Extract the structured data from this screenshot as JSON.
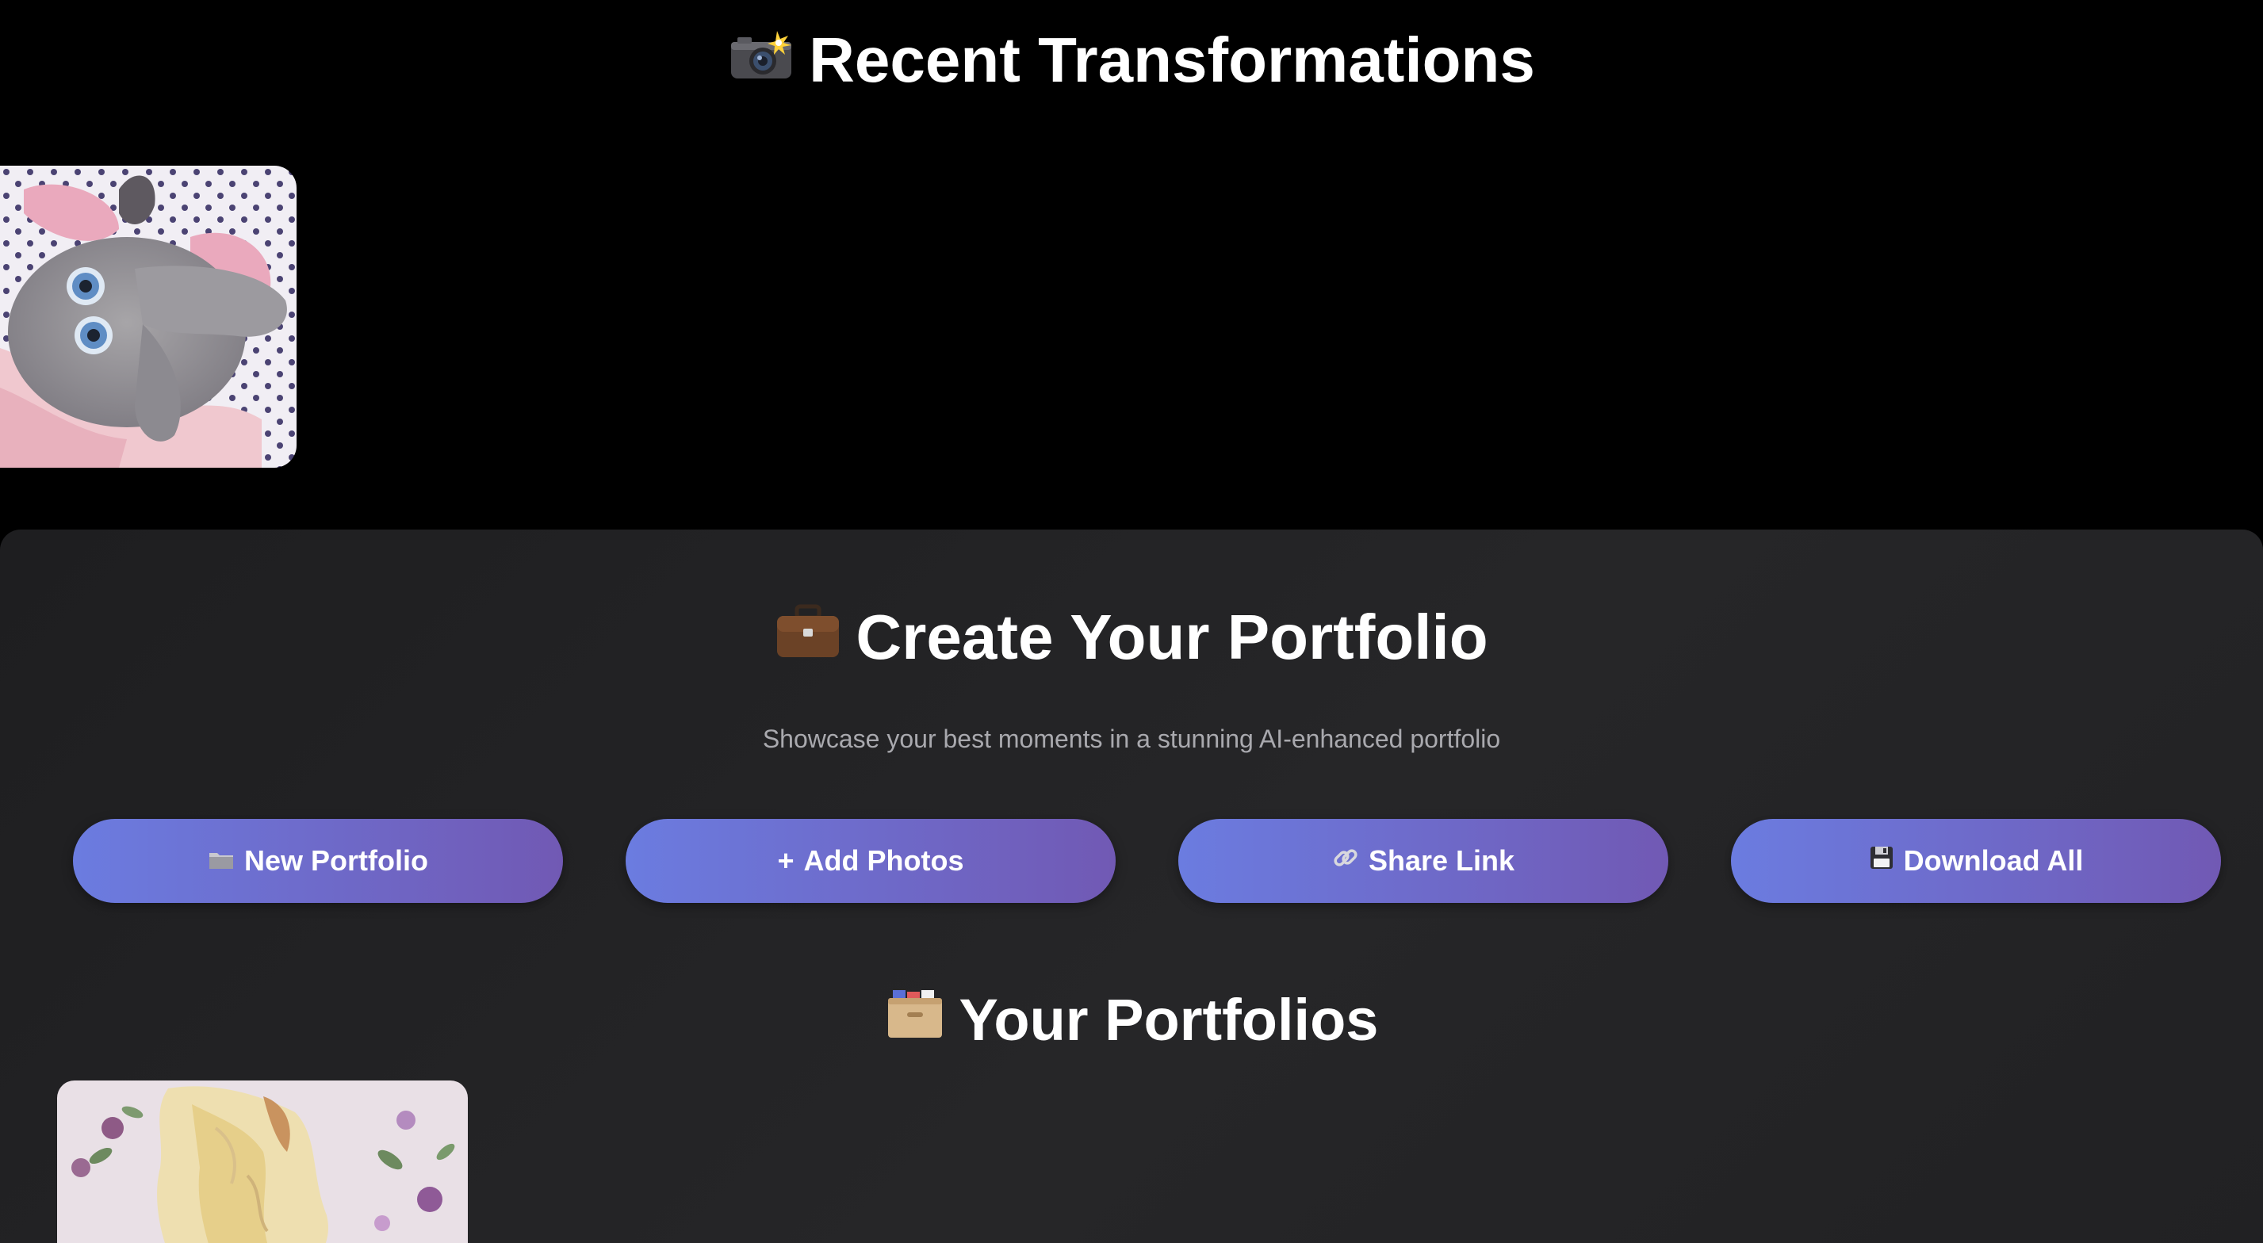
{
  "recent": {
    "icon": "camera-flash-icon",
    "title": "Recent Transformations",
    "thumbnail": "plush-elephant-photo"
  },
  "portfolio": {
    "icon": "briefcase-icon",
    "title": "Create Your Portfolio",
    "subtitle": "Showcase your best moments in a stunning AI-enhanced portfolio",
    "actions": [
      {
        "icon": "folder-icon",
        "label": "New Portfolio"
      },
      {
        "icon": "plus-icon",
        "glyph": "+",
        "label": "Add Photos"
      },
      {
        "icon": "link-icon",
        "label": "Share Link"
      },
      {
        "icon": "floppy-disk-icon",
        "label": "Download All"
      }
    ],
    "accent_gradient": [
      "#6b7ce0",
      "#7159b4"
    ]
  },
  "your_portfolios": {
    "icon": "card-file-box-icon",
    "title": "Your Portfolios",
    "cards": [
      {
        "thumbnail": "floral-collage-photo"
      }
    ]
  },
  "colors": {
    "background": "#000000",
    "panel": "#232325",
    "subtitle_text": "#a9a9ae",
    "title_text": "#ffffff"
  }
}
